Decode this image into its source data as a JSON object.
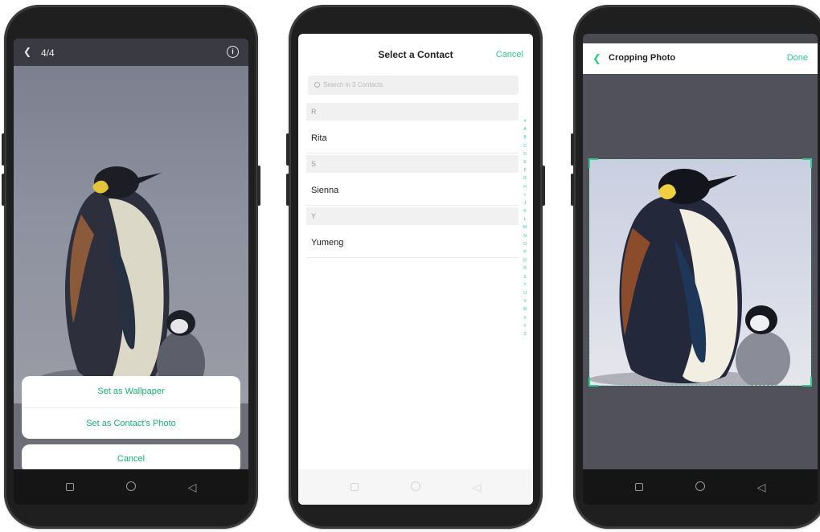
{
  "phone1": {
    "header": {
      "back_icon": "chevron-left-icon",
      "counter": "4/4",
      "info_icon": "info-icon",
      "info_glyph": "i"
    },
    "photo": "emperor-penguin-with-chick",
    "sheet": {
      "options": [
        "Set as Wallpaper",
        "Set as Contact's Photo"
      ],
      "cancel": "Cancel"
    },
    "nav": [
      "recents-square-icon",
      "home-circle-icon",
      "back-triangle-icon"
    ]
  },
  "phone2": {
    "header": {
      "title": "Select a Contact",
      "cancel": "Cancel"
    },
    "search": {
      "placeholder": "Search in 3 Contacts",
      "icon": "search-icon"
    },
    "sections": [
      {
        "letter": "R",
        "contacts": [
          "Rita"
        ]
      },
      {
        "letter": "S",
        "contacts": [
          "Sienna"
        ]
      },
      {
        "letter": "Y",
        "contacts": [
          "Yumeng"
        ]
      }
    ],
    "alphabet_index": [
      "#",
      "A",
      "B",
      "C",
      "D",
      "E",
      "F",
      "G",
      "H",
      "I",
      "J",
      "K",
      "L",
      "M",
      "N",
      "O",
      "P",
      "Q",
      "R",
      "S",
      "T",
      "U",
      "V",
      "W",
      "X",
      "Y",
      "Z"
    ],
    "nav": [
      "recents-square-icon",
      "home-circle-icon",
      "back-triangle-icon"
    ]
  },
  "phone3": {
    "header": {
      "back_icon": "chevron-left-icon",
      "title": "Cropping Photo",
      "done": "Done"
    },
    "photo": "emperor-penguin-with-chick",
    "nav": [
      "recents-square-icon",
      "home-circle-icon",
      "back-triangle-icon"
    ]
  },
  "colors": {
    "accent_green": "#2ecc88",
    "phone_frame": "#1f1f1f",
    "dim_overlay": "#6d6e78"
  }
}
